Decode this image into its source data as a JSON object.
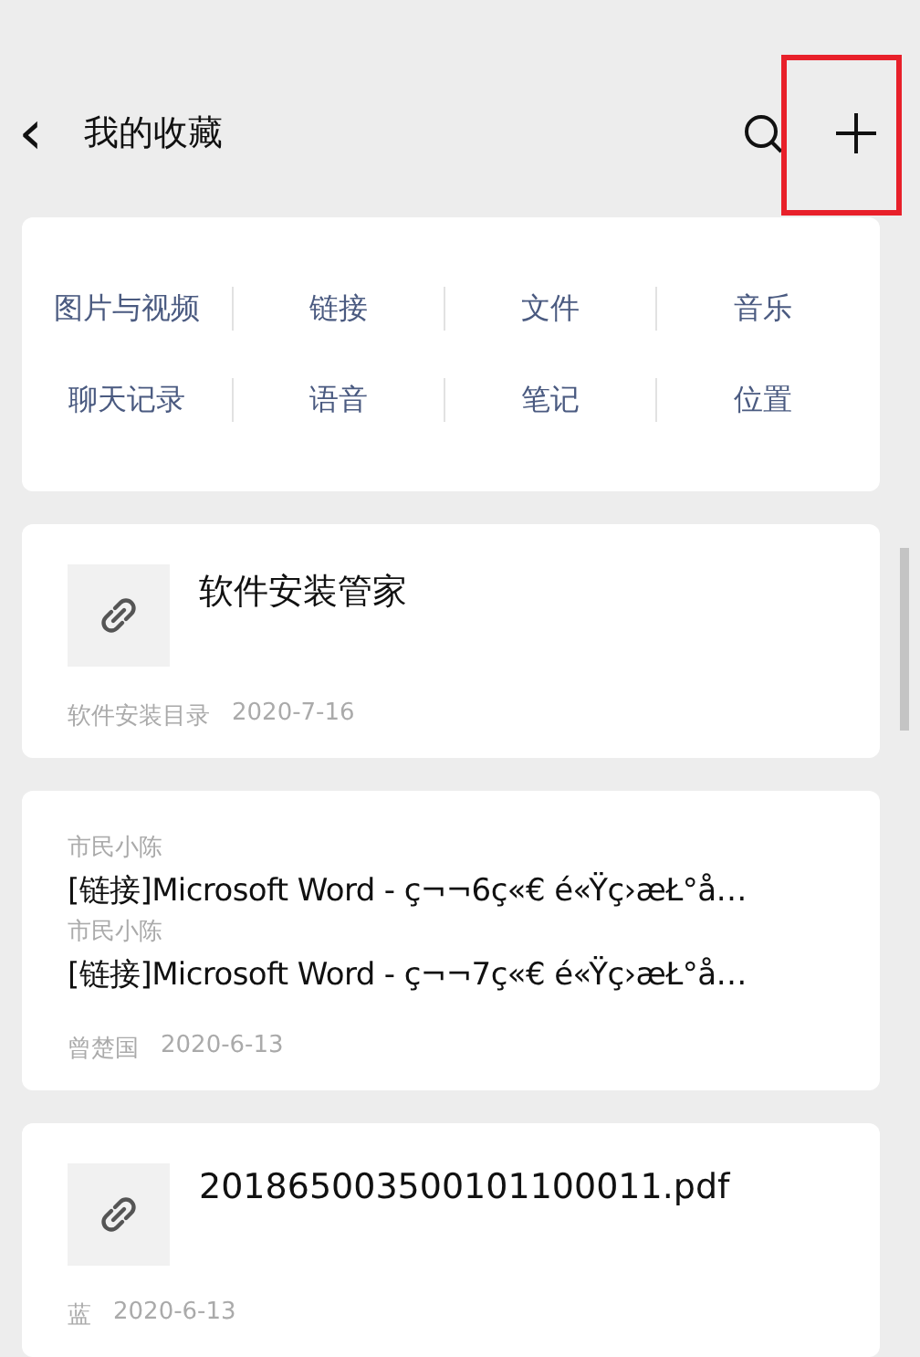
{
  "header": {
    "title": "我的收藏",
    "back_icon": "‹"
  },
  "categories": [
    {
      "label": "图片与视频"
    },
    {
      "label": "链接"
    },
    {
      "label": "文件"
    },
    {
      "label": "音乐"
    },
    {
      "label": "聊天记录"
    },
    {
      "label": "语音"
    },
    {
      "label": "笔记"
    },
    {
      "label": "位置"
    }
  ],
  "items": [
    {
      "kind": "link",
      "title": "软件安装管家",
      "source": "软件安装目录",
      "date": "2020-7-16"
    },
    {
      "kind": "chat",
      "messages": [
        {
          "sender": "市民小陈",
          "text": "[链接]Microsoft Word - ç¬¬6ç«€ é«Ÿç›æŁ°å…"
        },
        {
          "sender": "市民小陈",
          "text": "[链接]Microsoft Word - ç¬¬7ç«€ é«Ÿç›æŁ°å…"
        }
      ],
      "source": "曾楚国",
      "date": "2020-6-13"
    },
    {
      "kind": "link",
      "title": "201865003500101100011.pdf",
      "source": "蓝",
      "date": "2020-6-13"
    }
  ]
}
